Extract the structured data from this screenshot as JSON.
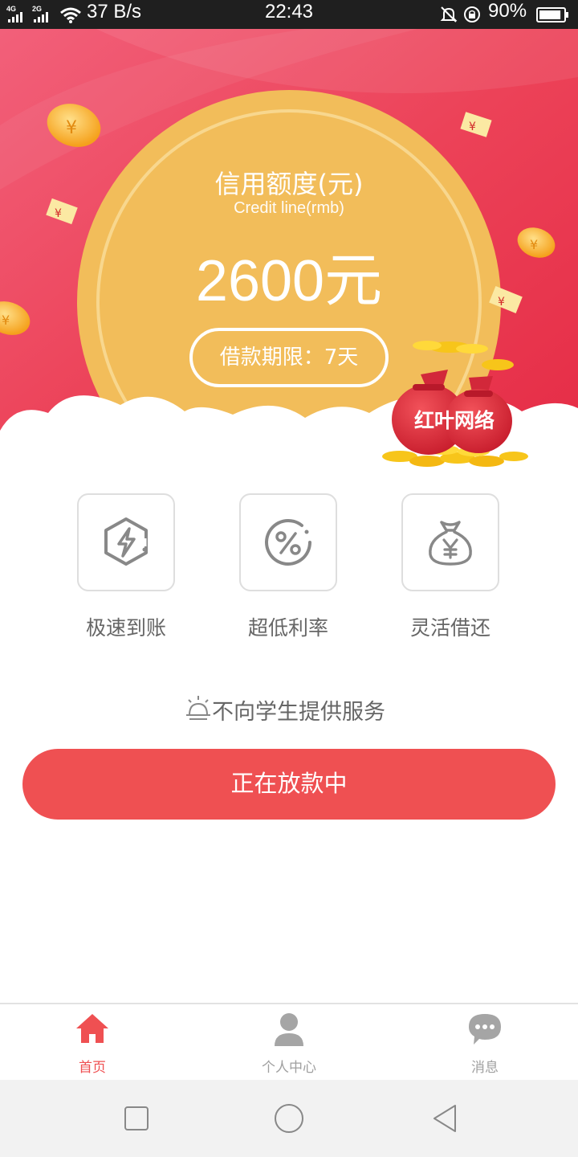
{
  "status_bar": {
    "net1": "4G",
    "net2": "2G",
    "speed": "37 B/s",
    "time": "22:43",
    "battery": "90%",
    "battery_level": 0.9
  },
  "hero": {
    "title": "信用额度(元)",
    "subtitle": "Credit line(rmb)",
    "amount": "2600元",
    "term": "借款期限：7天",
    "bag_label": "红叶网络"
  },
  "features": [
    {
      "label": "极速到账",
      "icon": "lightning-icon"
    },
    {
      "label": "超低利率",
      "icon": "percent-icon"
    },
    {
      "label": "灵活借还",
      "icon": "money-bag-icon"
    }
  ],
  "notice": {
    "text": "不向学生提供服务",
    "icon": "bell-icon"
  },
  "primary_button": {
    "label": "正在放款中"
  },
  "tabs": [
    {
      "label": "首页",
      "icon": "home-icon",
      "active": true
    },
    {
      "label": "个人中心",
      "icon": "user-icon",
      "active": false
    },
    {
      "label": "消息",
      "icon": "message-icon",
      "active": false
    }
  ],
  "colors": {
    "accent": "#ef5052",
    "hero_red": "#ea3a4e",
    "circle_gold": "#f2bd5a",
    "text_gray": "#666666",
    "tab_inactive": "#a0a0a0"
  }
}
